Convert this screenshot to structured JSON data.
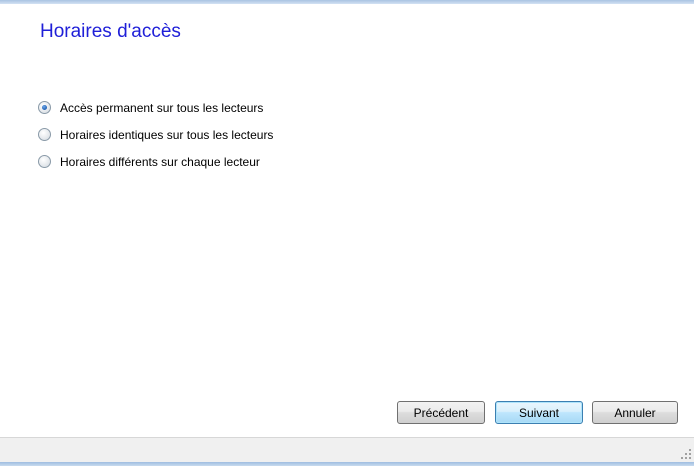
{
  "page": {
    "title": "Horaires d'accès"
  },
  "options": [
    {
      "label": "Accès permanent sur tous les lecteurs",
      "checked": true
    },
    {
      "label": "Horaires identiques sur tous les lecteurs",
      "checked": false
    },
    {
      "label": "Horaires différents sur chaque lecteur",
      "checked": false
    }
  ],
  "buttons": {
    "previous": "Précédent",
    "next": "Suivant",
    "cancel": "Annuler"
  },
  "colors": {
    "title": "#1f1fd8",
    "default_button_border": "#3c7fb1"
  }
}
